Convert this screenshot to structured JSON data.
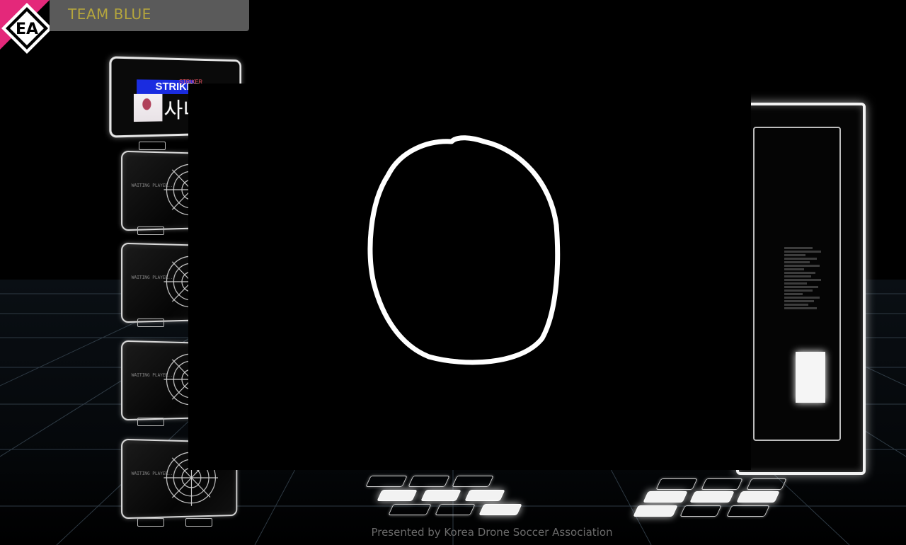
{
  "header": {
    "logo_text": "EA",
    "team_label": "TEAM BLUE"
  },
  "active_player": {
    "role_label": "STRIKER",
    "role_tag": "STRIKER",
    "name": "사니"
  },
  "waiting_slots": [
    {
      "label": "WAITING PLAYER..."
    },
    {
      "label": "WAITING PLAYER..."
    },
    {
      "label": "WAITING PLAYER..."
    },
    {
      "label": "WAITING PLAYER..."
    }
  ],
  "footer": {
    "credit": "Presented by Korea Drone Soccer Association"
  },
  "colors": {
    "team_label": "#b5a63d",
    "logo_accent": "#e4287a",
    "team_bar": "#5a5a5a",
    "striker_strip": "#1a2ce0"
  }
}
